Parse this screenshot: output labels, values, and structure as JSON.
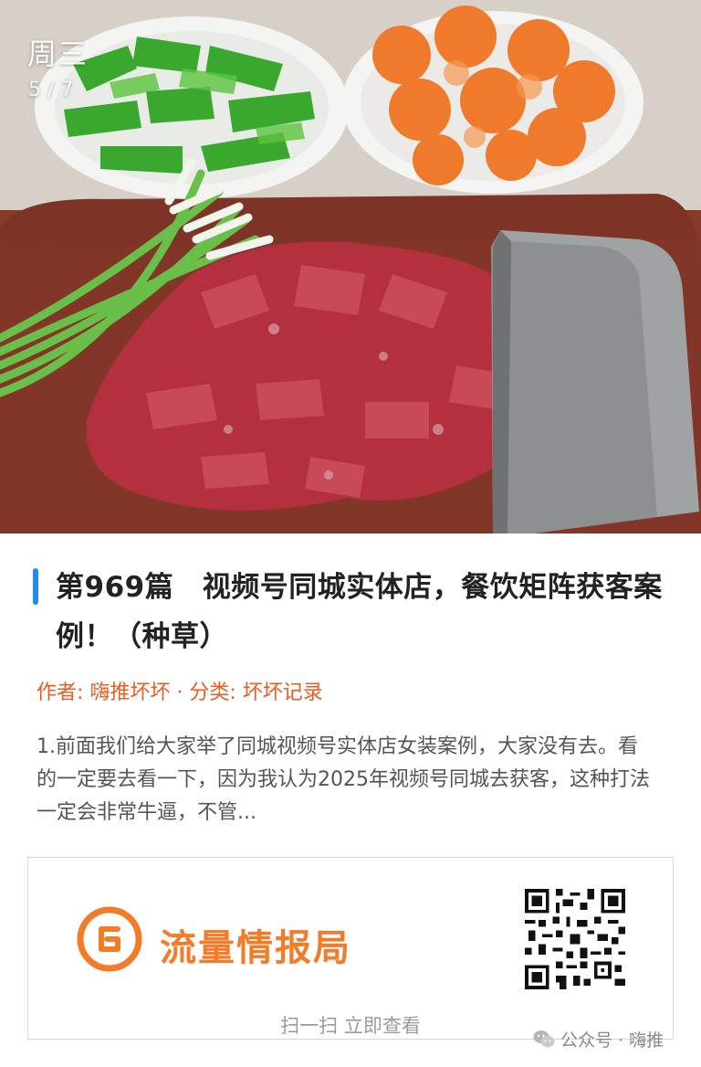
{
  "hero": {
    "day_label": "周三",
    "page_indicator": "5 / 7"
  },
  "article": {
    "title": "第969篇　视频号同城实体店，餐饮矩阵获客案例！（种草）",
    "meta": "作者: 嗨推坏坏 · 分类: 坏坏记录",
    "excerpt": "1.前面我们给大家举了同城视频号实体店女装案例，大家没有去。看的一定要去看一下，因为我认为2025年视频号同城去获客，这种打法一定会非常牛逼，不管..."
  },
  "card": {
    "brand_name": "流量情报局",
    "scan_hint": "扫一扫 立即查看",
    "logo_icon": "brand-circle-logo-icon",
    "qr_icon": "qr-code-icon"
  },
  "footer": {
    "credit": "公众号 · 嗨推"
  },
  "colors": {
    "accent_blue": "#1e8cf0",
    "meta_orange": "#f05a22",
    "brand_orange": "#f47b28"
  }
}
